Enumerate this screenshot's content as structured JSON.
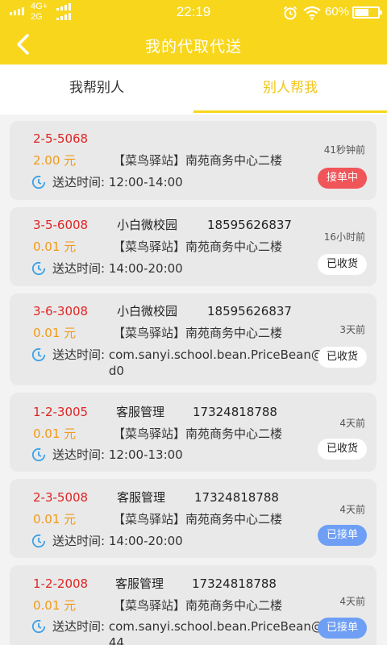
{
  "status_bar": {
    "network": "4G+",
    "network2": "2G",
    "time": "22:19",
    "battery_percent": "60%",
    "battery_level": 0.6
  },
  "header": {
    "title": "我的代取代送"
  },
  "tabs": [
    {
      "label": "我帮别人",
      "active": false
    },
    {
      "label": "别人帮我",
      "active": true
    }
  ],
  "orders": [
    {
      "order_no": "2-5-5068",
      "price": "2.00 元",
      "name": "",
      "phone": "",
      "address": "【菜鸟驿站】南苑商务中心二楼",
      "time_label": "送达时间:",
      "time_value": "12:00-14:00",
      "ago": "41秒钟前",
      "status": "接单中",
      "status_color": "#f0555a"
    },
    {
      "order_no": "3-5-6008",
      "price": "0.01 元",
      "name": "小白微校园",
      "phone": "18595626837",
      "address": "【菜鸟驿站】南苑商务中心二楼",
      "time_label": "送达时间:",
      "time_value": "14:00-20:00",
      "ago": "16小时前",
      "status": "已收货",
      "status_color": "#ffffff"
    },
    {
      "order_no": "3-6-3008",
      "price": "0.01 元",
      "name": "小白微校园",
      "phone": "18595626837",
      "address": "【菜鸟驿站】南苑商务中心二楼",
      "time_label": "送达时间:",
      "time_value": "com.sanyi.school.bean.PriceBean@d7b47d0",
      "ago": "3天前",
      "status": "已收货",
      "status_color": "#ffffff"
    },
    {
      "order_no": "1-2-3005",
      "price": "0.01 元",
      "name": "客服管理",
      "phone": "17324818788",
      "address": "【菜鸟驿站】南苑商务中心二楼",
      "time_label": "送达时间:",
      "time_value": "12:00-13:00",
      "ago": "4天前",
      "status": "已收货",
      "status_color": "#ffffff"
    },
    {
      "order_no": "2-3-5008",
      "price": "0.01 元",
      "name": "客服管理",
      "phone": "17324818788",
      "address": "【菜鸟驿站】南苑商务中心二楼",
      "time_label": "送达时间:",
      "time_value": "14:00-20:00",
      "ago": "4天前",
      "status": "已接单",
      "status_color": "#6e9ff5"
    },
    {
      "order_no": "1-2-2008",
      "price": "0.01 元",
      "name": "客服管理",
      "phone": "17324818788",
      "address": "【菜鸟驿站】南苑商务中心二楼",
      "time_label": "送达时间:",
      "time_value": "com.sanyi.school.bean.PriceBean@76edb44",
      "ago": "4天前",
      "status": "已接单",
      "status_color": "#6e9ff5"
    }
  ],
  "icons": {
    "back": "back-arrow-icon",
    "clock": "clock-icon",
    "alarm": "alarm-icon",
    "wifi": "wifi-icon",
    "battery": "battery-icon"
  },
  "colors": {
    "brand_yellow": "#f8d61c",
    "order_red": "#e02525",
    "price_orange": "#f09a1a",
    "clock_blue": "#3aa0e8"
  }
}
